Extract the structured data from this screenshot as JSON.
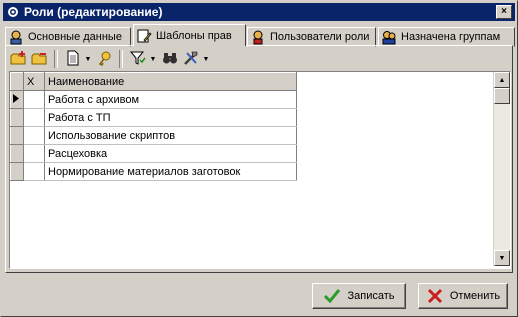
{
  "window": {
    "title": "Роли (редактирование)",
    "close_label": "×"
  },
  "tabs": [
    {
      "label": "Основные данные",
      "icon": "user-card-icon",
      "active": false
    },
    {
      "label": "Шаблоны прав",
      "icon": "document-edit-icon",
      "active": true
    },
    {
      "label": "Пользователи роли",
      "icon": "user-icon",
      "active": false
    },
    {
      "label": "Назначена группам",
      "icon": "group-icon",
      "active": false
    }
  ],
  "toolbar": {
    "buttons": [
      "add-row-icon",
      "delete-row-icon",
      "document-icon",
      "key-icon",
      "filter-icon",
      "binoculars-icon",
      "tools-icon"
    ]
  },
  "grid": {
    "columns": [
      "X",
      "Наименование"
    ],
    "rows": [
      {
        "name": "Работа с архивом",
        "current": true
      },
      {
        "name": "Работа с ТП",
        "current": false
      },
      {
        "name": "Использование скриптов",
        "current": false
      },
      {
        "name": "Расцеховка",
        "current": false
      },
      {
        "name": "Нормирование материалов заготовок",
        "current": false
      }
    ]
  },
  "actions": {
    "save_label": "Записать",
    "cancel_label": "Отменить"
  },
  "colors": {
    "titlebar": "#0a246a",
    "ok_green": "#2e9a2e",
    "cancel_red": "#c81e1e"
  }
}
